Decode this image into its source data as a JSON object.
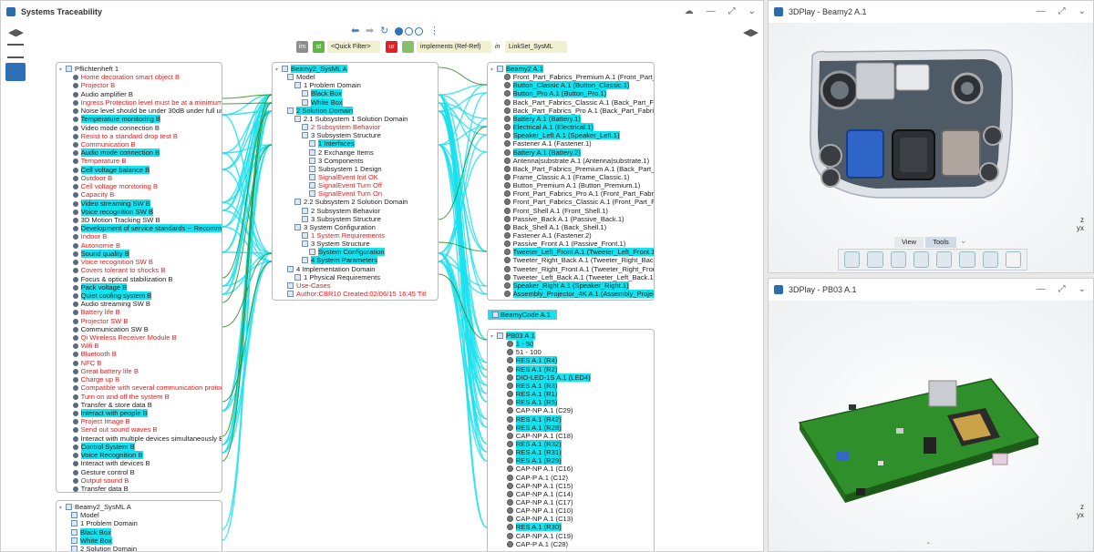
{
  "traceability": {
    "title": "Systems Traceability",
    "quick_filter": "<Quick Filter>",
    "filter_chip_im": "im",
    "filter_chip_st": "st",
    "filter_chip_ur": "ur",
    "relation": "implements (Ref-Ref)",
    "in_label": "in",
    "link_set": "LinkSet_SysML"
  },
  "left_tree": {
    "root": "Pflichtenheft 1",
    "items": [
      {
        "t": "Home decoration smart object B",
        "c": "red"
      },
      {
        "t": "Projector B",
        "c": "red"
      },
      {
        "t": "Audio amplifier B",
        "c": "n"
      },
      {
        "t": "Ingress Protection level must be at a minimum",
        "c": "red"
      },
      {
        "t": "Noise level should be under 30dB under full us",
        "c": "n"
      },
      {
        "t": "Temperature monitoring B",
        "c": "hl"
      },
      {
        "t": "Video mode connection B",
        "c": "n"
      },
      {
        "t": "Resist to a standard drop test B",
        "c": "red"
      },
      {
        "t": "Communication B",
        "c": "red"
      },
      {
        "t": "Audio mode connection B",
        "c": "hl"
      },
      {
        "t": "Temperature B",
        "c": "red"
      },
      {
        "t": "Cell voltage balance B",
        "c": "hl"
      },
      {
        "t": "Outdoor B",
        "c": "red"
      },
      {
        "t": "Cell voltage monitoring B",
        "c": "red"
      },
      {
        "t": "Capacity B",
        "c": "red"
      },
      {
        "t": "Video streaming SW B",
        "c": "hl"
      },
      {
        "t": "Voice recognition SW B",
        "c": "hl"
      },
      {
        "t": "3D Motion Tracking SW B",
        "c": "n"
      },
      {
        "t": "Development of service standards -- Recomme",
        "c": "hl"
      },
      {
        "t": "Indoor B",
        "c": "red"
      },
      {
        "t": "Autonomie B",
        "c": "red"
      },
      {
        "t": "Sound quality B",
        "c": "hl"
      },
      {
        "t": "Voice recognition SW B",
        "c": "red"
      },
      {
        "t": "Covers tolerant to shocks B",
        "c": "red"
      },
      {
        "t": "Focus & optical stabilization B",
        "c": "n"
      },
      {
        "t": "Pack voltage B",
        "c": "hl"
      },
      {
        "t": "Quiet cooling system B",
        "c": "hl"
      },
      {
        "t": "Audio streaming SW B",
        "c": "n"
      },
      {
        "t": "Battery life B",
        "c": "red"
      },
      {
        "t": "Projector SW B",
        "c": "red"
      },
      {
        "t": "Communication SW B",
        "c": "n"
      },
      {
        "t": "Qi Wireless Receiver Module B",
        "c": "red"
      },
      {
        "t": "Wifi B",
        "c": "red"
      },
      {
        "t": "Bluetooth B",
        "c": "red"
      },
      {
        "t": "NFC B",
        "c": "red"
      },
      {
        "t": "Great battery life B",
        "c": "red"
      },
      {
        "t": "Charge up B",
        "c": "red"
      },
      {
        "t": "Compatible with several communication protoc",
        "c": "red"
      },
      {
        "t": "Turn on and off the system B",
        "c": "red"
      },
      {
        "t": "Transfer & store data B",
        "c": "n"
      },
      {
        "t": "Interact with people B",
        "c": "hl"
      },
      {
        "t": "Project Image B",
        "c": "red"
      },
      {
        "t": "Send out sound waves B",
        "c": "red"
      },
      {
        "t": "Interact with multiple devices simultaneously B",
        "c": "n"
      },
      {
        "t": "Control System B",
        "c": "hl"
      },
      {
        "t": "Voice Recognition B",
        "c": "hl"
      },
      {
        "t": "Interact with devices B",
        "c": "n"
      },
      {
        "t": "Gesture control B",
        "c": "n"
      },
      {
        "t": "Output sound B",
        "c": "red"
      },
      {
        "t": "Transfer data B",
        "c": "n"
      }
    ]
  },
  "left_tree2": {
    "root": "Beamy2_SysML A",
    "items": [
      {
        "t": "Model",
        "c": "n"
      },
      {
        "t": "1 Problem Domain",
        "c": "n"
      },
      {
        "t": "Black Box",
        "c": "hl"
      },
      {
        "t": "White Box",
        "c": "hl"
      },
      {
        "t": "2 Solution Domain",
        "c": "n"
      }
    ]
  },
  "mid_tree": {
    "root": "Beamy2_SysML A",
    "items": [
      {
        "t": "Model",
        "c": "n",
        "i": 1
      },
      {
        "t": "1 Problem Domain",
        "c": "n",
        "i": 2
      },
      {
        "t": "Black Box",
        "c": "hl",
        "i": 3
      },
      {
        "t": "White Box",
        "c": "hl",
        "i": 3
      },
      {
        "t": "2 Solution Domain",
        "c": "hl",
        "i": 1
      },
      {
        "t": "2.1 Subsystem 1 Solution Domain",
        "c": "n",
        "i": 2
      },
      {
        "t": "2 Subsystem Behavior",
        "c": "red",
        "i": 3
      },
      {
        "t": "3 Subsystem Structure",
        "c": "n",
        "i": 3
      },
      {
        "t": "1 Interfaces",
        "c": "hl",
        "i": 4
      },
      {
        "t": "2 Exchange Items",
        "c": "n",
        "i": 4
      },
      {
        "t": "3 Components",
        "c": "n",
        "i": 4
      },
      {
        "t": "Subsystem 1 Design",
        "c": "n",
        "i": 4
      },
      {
        "t": "SignalEvent Init OK",
        "c": "red",
        "i": 4
      },
      {
        "t": "SignalEvent Turn Off",
        "c": "red",
        "i": 4
      },
      {
        "t": "SignalEvent Turn On",
        "c": "red",
        "i": 4
      },
      {
        "t": "2.2 Subsystem 2 Solution Domain",
        "c": "n",
        "i": 2
      },
      {
        "t": "2 Subsystem Behavior",
        "c": "n",
        "i": 3
      },
      {
        "t": "3 Subsystem Structure",
        "c": "n",
        "i": 3
      },
      {
        "t": "3 System Configuration",
        "c": "n",
        "i": 2
      },
      {
        "t": "1 System Requirements",
        "c": "red",
        "i": 3
      },
      {
        "t": "3 System Structure",
        "c": "n",
        "i": 3
      },
      {
        "t": "System Configuration",
        "c": "hl",
        "i": 4
      },
      {
        "t": "4 System Parameters",
        "c": "hl",
        "i": 3
      },
      {
        "t": "4 Implementation Domain",
        "c": "n",
        "i": 1
      },
      {
        "t": "1 Physical Requirements",
        "c": "n",
        "i": 2
      },
      {
        "t": "Use-Cases",
        "c": "red",
        "i": 1
      },
      {
        "t": "Author:CBR10  Created:02/06/15 16:45  Titl",
        "c": "red",
        "i": 1
      }
    ]
  },
  "right_tree": {
    "root": "Beamy2 A.1",
    "items": [
      {
        "t": "Front_Part_Fabrics_Premium A.1 (Front_Part_",
        "c": "n"
      },
      {
        "t": "Button_Classic A.1 (Button_Classic.1)",
        "c": "hl"
      },
      {
        "t": "Button_Pro A.1 (Button_Pro.1)",
        "c": "hl"
      },
      {
        "t": "Back_Part_Fabrics_Classic A.1 (Back_Part_Fa",
        "c": "n"
      },
      {
        "t": "Back_Part_Fabrics_Pro A.1 (Back_Part_Fabric",
        "c": "n"
      },
      {
        "t": "Battery A.1 (Battery.1)",
        "c": "hl"
      },
      {
        "t": "Electrical A.1 (Electrical.1)",
        "c": "hl"
      },
      {
        "t": "Speaker_Left A.1 (Speaker_Left.1)",
        "c": "hl"
      },
      {
        "t": "Fastener A.1 (Fastener.1)",
        "c": "n"
      },
      {
        "t": "Battery A.1 (Battery.2)",
        "c": "hl"
      },
      {
        "t": "Antenna|substrate A.1 (Antenna|substrate.1)",
        "c": "n"
      },
      {
        "t": "Back_Part_Fabrics_Premium A.1 (Back_Part_",
        "c": "n"
      },
      {
        "t": "Frame_Classic A.1 (Frame_Classic.1)",
        "c": "n"
      },
      {
        "t": "Button_Premium A.1 (Button_Premium.1)",
        "c": "n"
      },
      {
        "t": "Front_Part_Fabrics_Pro A.1 (Front_Part_Fabri",
        "c": "n"
      },
      {
        "t": "Front_Part_Fabrics_Classic A.1 (Front_Part_F",
        "c": "n"
      },
      {
        "t": "Front_Shell A.1 (Front_Shell.1)",
        "c": "n"
      },
      {
        "t": "Passive_Back A.1 (Passive_Back.1)",
        "c": "n"
      },
      {
        "t": "Back_Shell A.1 (Back_Shell.1)",
        "c": "n"
      },
      {
        "t": "Fastener A.1 (Fastener.2)",
        "c": "n"
      },
      {
        "t": "Passive_Front A.1 (Passive_Front.1)",
        "c": "n"
      },
      {
        "t": "Tweeter_Left_Front A.1 (Tweeter_Left_Front.1",
        "c": "hl"
      },
      {
        "t": "Tweeter_Right_Back A.1 (Tweeter_Right_Back",
        "c": "n"
      },
      {
        "t": "Tweeter_Right_Front A.1 (Tweeter_Right_Fron",
        "c": "n"
      },
      {
        "t": "Tweeter_Left_Back A.1 (Tweeter_Left_Back.1)",
        "c": "n"
      },
      {
        "t": "Speaker_Right A.1 (Speaker_Right.1)",
        "c": "hl"
      },
      {
        "t": "Assembly_Projector_4K A.1 (Assembly_Projec",
        "c": "hl"
      }
    ]
  },
  "beamycode": "BeamyCode A.1",
  "pb_tree": {
    "root": "PB03 A.1",
    "items": [
      {
        "t": "1 - 50",
        "c": "hl"
      },
      {
        "t": "51 - 100",
        "c": "n"
      },
      {
        "t": "RES A.1 (R4)",
        "c": "hl"
      },
      {
        "t": "RES A.1 (R2)",
        "c": "hl"
      },
      {
        "t": "DIO-LED-1S A.1 (LED4)",
        "c": "hl"
      },
      {
        "t": "RES A.1 (R3)",
        "c": "hl"
      },
      {
        "t": "RES A.1 (R1)",
        "c": "hl"
      },
      {
        "t": "RES A.1 (R5)",
        "c": "hl"
      },
      {
        "t": "CAP-NP A.1 (C29)",
        "c": "n"
      },
      {
        "t": "RES A.1 (R42)",
        "c": "hl"
      },
      {
        "t": "RES A.1 (R28)",
        "c": "hl"
      },
      {
        "t": "CAP-NP A.1 (C18)",
        "c": "n"
      },
      {
        "t": "RES A.1 (R32)",
        "c": "hl"
      },
      {
        "t": "RES A.1 (R31)",
        "c": "hl"
      },
      {
        "t": "RES A.1 (R29)",
        "c": "hl"
      },
      {
        "t": "CAP-NP A.1 (C16)",
        "c": "n"
      },
      {
        "t": "CAP-P A.1 (C12)",
        "c": "n"
      },
      {
        "t": "CAP-NP A.1 (C15)",
        "c": "n"
      },
      {
        "t": "CAP-NP A.1 (C14)",
        "c": "n"
      },
      {
        "t": "CAP-NP A.1 (C17)",
        "c": "n"
      },
      {
        "t": "CAP-NP A.1 (C10)",
        "c": "n"
      },
      {
        "t": "CAP-NP A.1 (C13)",
        "c": "n"
      },
      {
        "t": "RES A.1 (R30)",
        "c": "hl"
      },
      {
        "t": "CAP-NP A.1 (C19)",
        "c": "n"
      },
      {
        "t": "CAP-P A.1 (C28)",
        "c": "n"
      }
    ]
  },
  "viewer1": {
    "title": "3DPlay - Beamy2 A.1",
    "tab_view": "View",
    "tab_tools": "Tools",
    "axis_z": "z",
    "axis_yx": "yx"
  },
  "viewer2": {
    "title": "3DPlay - PB03 A.1",
    "axis_z": "z",
    "axis_yx": "yx"
  },
  "colors": {
    "highlight": "#11e3f0",
    "link_cyan": "#1ae0ee",
    "link_green": "#2e8a1e",
    "req_red": "#e02020",
    "accent_blue": "#2f6fb8"
  }
}
